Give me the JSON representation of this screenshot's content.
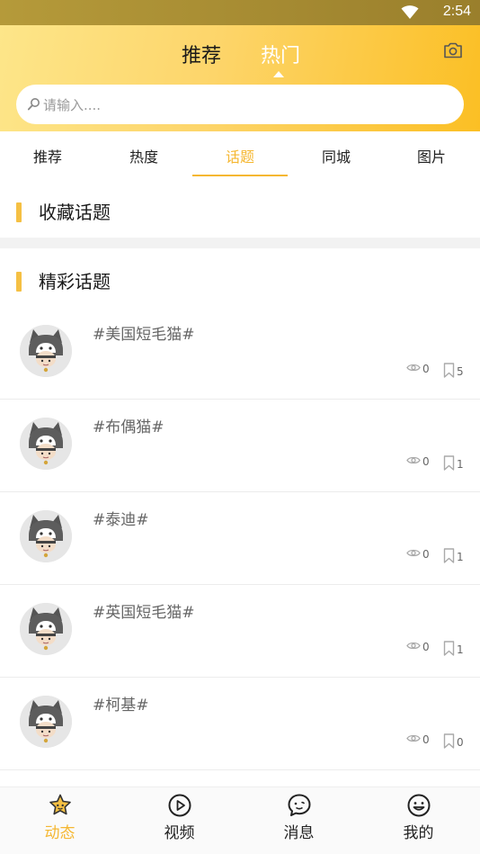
{
  "status_bar": {
    "time": "2:54"
  },
  "header": {
    "tabs": [
      {
        "label": "推荐"
      },
      {
        "label": "热门"
      }
    ],
    "active_tab": "热门",
    "search_placeholder": "请输入...."
  },
  "sub_tabs": [
    {
      "label": "推荐"
    },
    {
      "label": "热度"
    },
    {
      "label": "话题"
    },
    {
      "label": "同城"
    },
    {
      "label": "图片"
    }
  ],
  "active_sub_tab": "话题",
  "sections": {
    "favorites_title": "收藏话题",
    "featured_title": "精彩话题"
  },
  "topics": [
    {
      "name": "#美国短毛猫#",
      "views": "0",
      "saves": "5"
    },
    {
      "name": "#布偶猫#",
      "views": "0",
      "saves": "1"
    },
    {
      "name": "#泰迪#",
      "views": "0",
      "saves": "1"
    },
    {
      "name": "#英国短毛猫#",
      "views": "0",
      "saves": "1"
    },
    {
      "name": "#柯基#",
      "views": "0",
      "saves": "0"
    }
  ],
  "bottom_nav": [
    {
      "label": "动态",
      "icon": "star-face-icon"
    },
    {
      "label": "视频",
      "icon": "play-circle-icon"
    },
    {
      "label": "消息",
      "icon": "chat-bubble-icon"
    },
    {
      "label": "我的",
      "icon": "smile-face-icon"
    }
  ],
  "active_bottom_nav": "动态",
  "colors": {
    "accent": "#f5b731",
    "header_start": "#fde68a",
    "header_end": "#fbbf24"
  }
}
